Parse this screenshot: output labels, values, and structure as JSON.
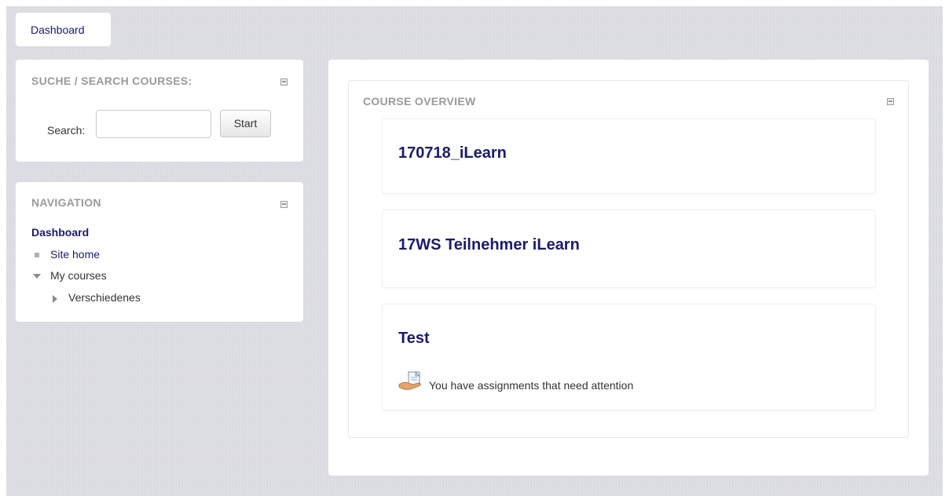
{
  "breadcrumb": {
    "dashboard_label": "Dashboard"
  },
  "search_block": {
    "title": "SUCHE / SEARCH COURSES:",
    "search_label": "Search:",
    "search_value": "",
    "start_button_label": "Start"
  },
  "navigation_block": {
    "title": "NAVIGATION",
    "dashboard_label": "Dashboard",
    "site_home_label": "Site home",
    "my_courses_label": "My courses",
    "verschiedenes_label": "Verschiedenes"
  },
  "course_overview": {
    "title": "COURSE OVERVIEW",
    "courses": [
      {
        "name": "170718_iLearn"
      },
      {
        "name": "17WS Teilnehmer iLearn"
      },
      {
        "name": "Test",
        "notice": "You have assignments that need attention"
      }
    ]
  },
  "colors": {
    "link": "#1a1a73",
    "block_title": "#9a9a9a",
    "page_background": "#dcdce3"
  }
}
